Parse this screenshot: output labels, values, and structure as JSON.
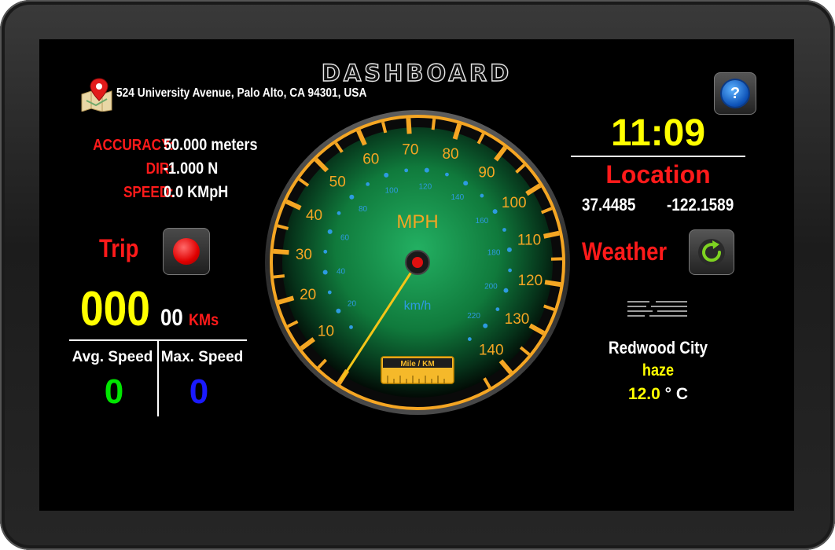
{
  "app": {
    "title": "DASHBOARD"
  },
  "address": "524 University Avenue, Palo Alto, CA 94301, USA",
  "info": {
    "accuracy_label": "ACCURACY:",
    "accuracy_value": "50.000 meters",
    "dir_label": "DIR:",
    "dir_value": "-1.000 N",
    "speed_label": "SPEED:",
    "speed_value": "0.0 KMpH"
  },
  "trip": {
    "label": "Trip",
    "odometer_main": "000",
    "odometer_decimal": "00",
    "odometer_unit": "KMs"
  },
  "stats": {
    "avg_label": "Avg. Speed",
    "avg_value": "0",
    "max_label": "Max. Speed",
    "max_value": "0"
  },
  "clock": "11:09",
  "location": {
    "title": "Location",
    "lat": "37.4485",
    "lon": "-122.1589"
  },
  "weather": {
    "label": "Weather",
    "city": "Redwood City",
    "condition": "haze",
    "temp": "12.0",
    "temp_unit": "° C"
  },
  "gauge": {
    "mph_label": "MPH",
    "kmh_label": "km/h",
    "mile_km_label": "Mile / KM",
    "mph_ticks": [
      "10",
      "20",
      "30",
      "40",
      "50",
      "60",
      "70",
      "80",
      "90",
      "100",
      "110",
      "120",
      "130",
      "140"
    ],
    "kmh_ticks": [
      "20",
      "40",
      "60",
      "80",
      "100",
      "120",
      "140",
      "160",
      "180",
      "200",
      "220"
    ],
    "needle_value_mph": 0
  },
  "colors": {
    "accent_red": "#ff1a1a",
    "accent_yellow": "#ffff00",
    "avg_speed": "#00e600",
    "max_speed": "#1a1aff",
    "gauge_ring": "#f5a623",
    "gauge_face": "#1fa35a",
    "kmh_text": "#2d9be0"
  },
  "icons": {
    "map": "map-pin-icon",
    "help": "help-icon",
    "record": "record-icon",
    "refresh": "refresh-icon",
    "haze": "haze-icon"
  }
}
